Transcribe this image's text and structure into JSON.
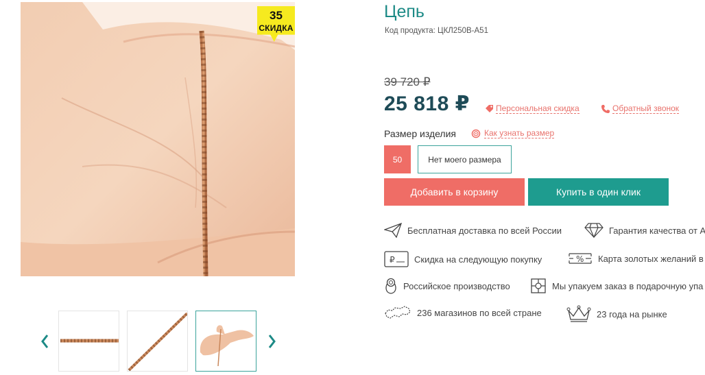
{
  "gallery": {
    "discount_badge": {
      "value": "35",
      "label": "СКИДКА",
      "color": "#f6ea1f"
    },
    "main_image": "hand-with-gold-chain",
    "thumbnails": [
      {
        "image": "chain-horizontal",
        "active": false
      },
      {
        "image": "chain-diagonal",
        "active": false
      },
      {
        "image": "hand-with-chain",
        "active": true
      }
    ],
    "prev_icon": "chevron-left-icon",
    "next_icon": "chevron-right-icon"
  },
  "product": {
    "title": "Цепь",
    "sku": "Код продукта: ЦКЛ250В-А51",
    "old_price": "39 720 ₽",
    "price": "25 818 ₽",
    "personal_discount": "Персональная скидка",
    "callback": "Обратный звонок",
    "size_label": "Размер изделия",
    "size_help": "Как узнать размер",
    "sizes": [
      {
        "label": "50",
        "selected": true
      },
      {
        "label": "Нет моего размера",
        "selected": false
      }
    ],
    "add_to_cart": "Добавить в корзину",
    "buy_one_click": "Купить в один клик"
  },
  "benefits": [
    {
      "icon": "paper-plane-icon",
      "text": "Бесплатная доставка по всей России"
    },
    {
      "icon": "diamond-icon",
      "text": "Гарантия качества от А"
    },
    {
      "icon": "card-icon",
      "text": "Скидка на следующую покупку"
    },
    {
      "icon": "percent-card-icon",
      "text": "Карта золотых желаний в"
    },
    {
      "icon": "matryoshka-icon",
      "text": "Российское производство"
    },
    {
      "icon": "gift-box-icon",
      "text": "Мы упакуем заказ в подарочную упа"
    },
    {
      "icon": "russia-map-icon",
      "text": "236 магазинов по всей стране"
    },
    {
      "icon": "crown-icon",
      "text": "23 года на рынке"
    }
  ],
  "colors": {
    "accent_teal": "#1c8a86",
    "price_dark": "#1e4b57",
    "coral": "#ef6d66",
    "teal_button": "#1e9c8f"
  }
}
